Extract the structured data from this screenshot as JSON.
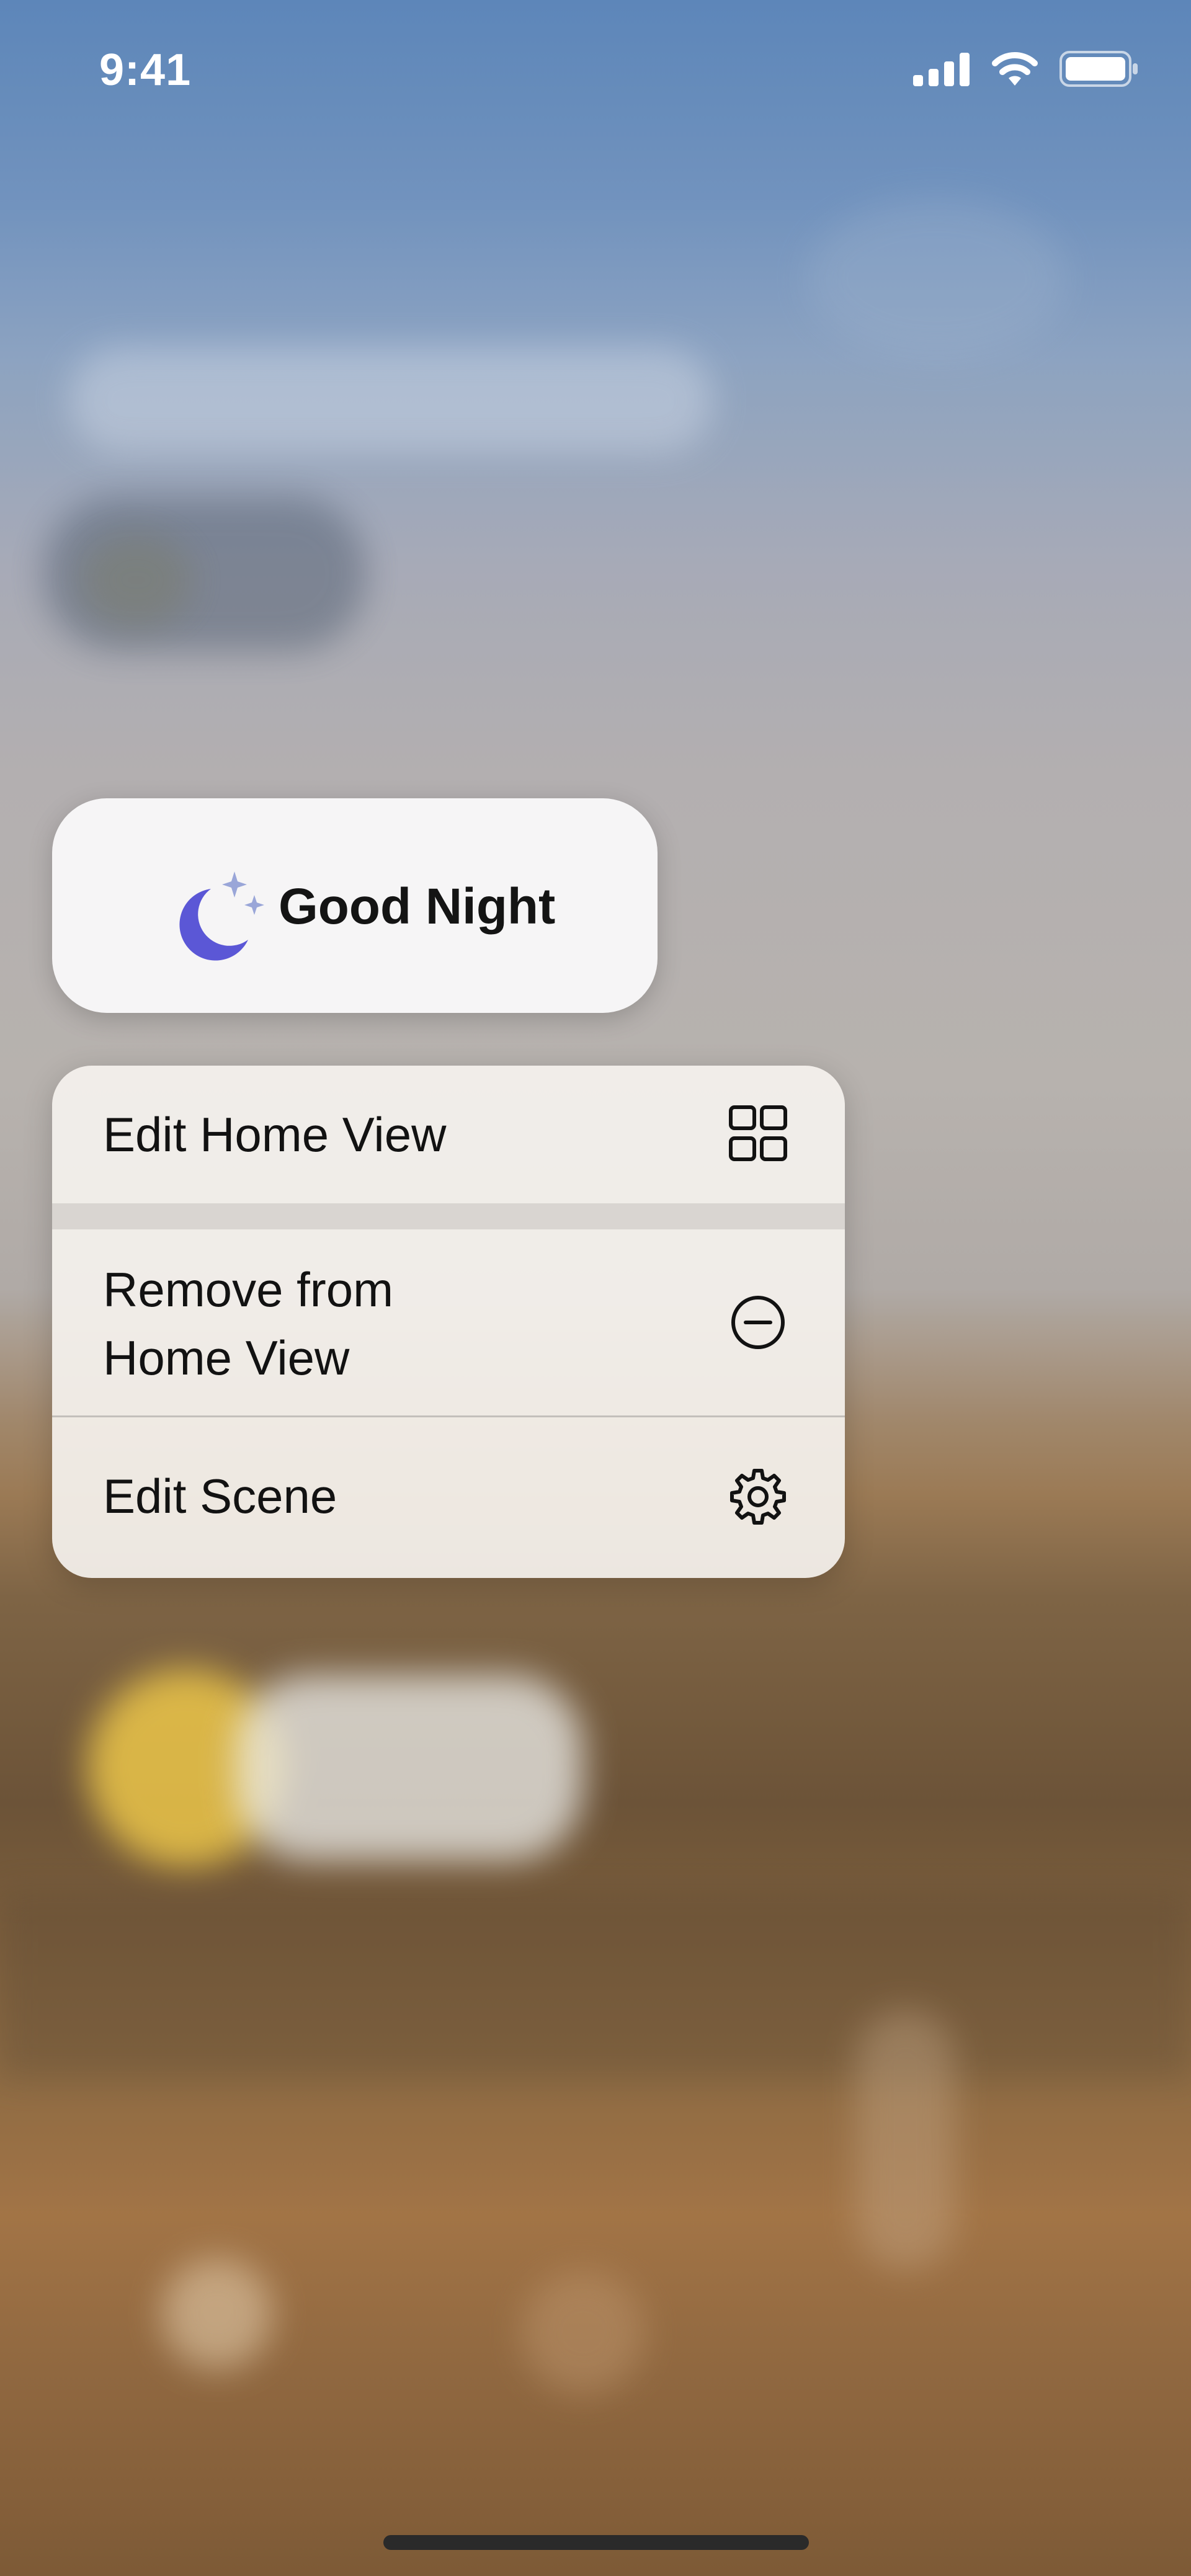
{
  "status_bar": {
    "time": "9:41",
    "icons": [
      "cellular-signal-icon",
      "wifi-icon",
      "battery-icon"
    ]
  },
  "scene_tile": {
    "name": "Good Night",
    "icon": "moon-stars-icon",
    "icon_color": "#5b57d6"
  },
  "context_menu": {
    "items": [
      {
        "label": "Edit Home View",
        "icon": "grid-icon"
      },
      {
        "label": "Remove from Home View",
        "label_line1": "Remove from",
        "label_line2": "Home View",
        "icon": "minus-circle-icon"
      },
      {
        "label": "Edit Scene",
        "icon": "gear-icon"
      }
    ]
  },
  "colors": {
    "menu_background": "#f5f2ee",
    "tile_background": "#f6f5f6",
    "text": "#121212"
  }
}
